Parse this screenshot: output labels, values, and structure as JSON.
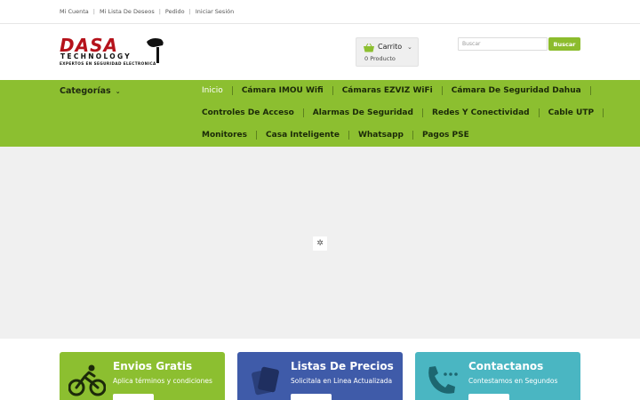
{
  "topbar": {
    "links": [
      "Mi Cuenta",
      "Mi Lista De Deseos",
      "Pedido",
      "Iniciar Sesión"
    ]
  },
  "logo": {
    "word": "DASA",
    "tech": "TECHNOLOGY",
    "tagline": "EXPERTOS EN SEGURIDAD ELECTRONICA"
  },
  "cart": {
    "label": "Carrito",
    "count": "0 Producto"
  },
  "search": {
    "placeholder": "Buscar",
    "button": "Buscar"
  },
  "nav": {
    "categories": "Categorías",
    "rows": [
      [
        "Inicio",
        "Cámara IMOU Wifi",
        "Cámaras EZVIZ WiFi",
        "Cámara De Seguridad Dahua"
      ],
      [
        "Controles De Acceso",
        "Alarmas De Seguridad",
        "Redes Y Conectividad",
        "Cable UTP"
      ],
      [
        "Monitores",
        "Casa Inteligente",
        "Whatsapp",
        "Pagos PSE"
      ]
    ]
  },
  "features": [
    {
      "title": "Envios Gratis",
      "subtitle": "Aplica términos y condiciones",
      "icon": "cyclist-icon"
    },
    {
      "title": "Listas De Precios",
      "subtitle": "Solicitala en Linea Actualizada",
      "icon": "price-list-icon"
    },
    {
      "title": "Contactanos",
      "subtitle": "Contestamos en Segundos",
      "icon": "phone-icon"
    }
  ],
  "colors": {
    "brand_green": "#8cbf30",
    "logo_red": "#b5121b",
    "card_blue": "#3f5ba9",
    "card_teal": "#4ab6c2"
  }
}
